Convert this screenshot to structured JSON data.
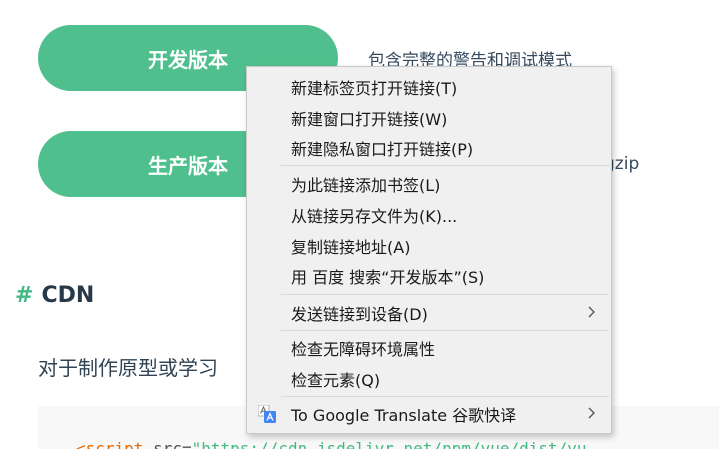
{
  "page": {
    "dev_button": "开发版本",
    "dev_desc": "包含完整的警告和调试模式",
    "prod_button": "生产版本",
    "prod_desc_partial": "gzip",
    "heading_hash": "#",
    "heading": "CDN",
    "paragraph_partial": "对于制作原型或学习",
    "code_tag": "<script",
    "code_attr": " src=",
    "code_string": "\"https://cdn.jsdelivr.net/npm/vue/dist/vu"
  },
  "menu": {
    "items": [
      {
        "label": "新建标签页打开链接(T)"
      },
      {
        "label": "新建窗口打开链接(W)"
      },
      {
        "label": "新建隐私窗口打开链接(P)"
      },
      {
        "label": "为此链接添加书签(L)"
      },
      {
        "label": "从链接另存文件为(K)..."
      },
      {
        "label": "复制链接地址(A)"
      },
      {
        "label": "用 百度 搜索“开发版本”(S)"
      },
      {
        "label": "发送链接到设备(D)"
      },
      {
        "label": "检查无障碍环境属性"
      },
      {
        "label": "检查元素(Q)"
      },
      {
        "label": "To Google Translate 谷歌快译"
      }
    ]
  },
  "colors": {
    "accent": "#4fc08d",
    "menu_bg": "#f0f0f0"
  },
  "icons": {
    "submenu": "chevron-right-icon",
    "translate": "google-translate-icon"
  }
}
